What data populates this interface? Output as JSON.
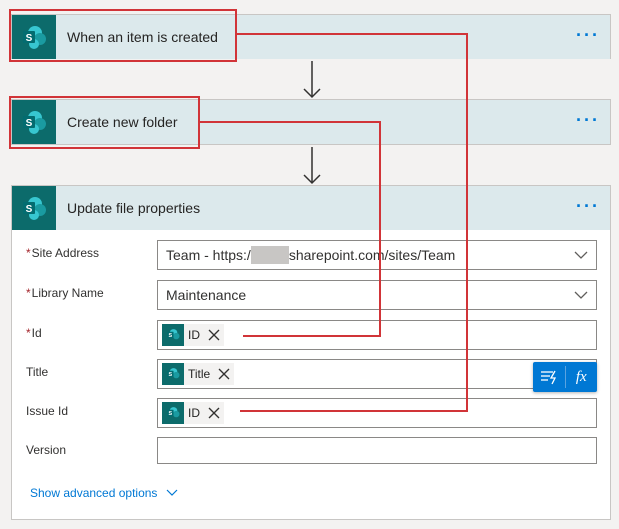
{
  "colors": {
    "accent": "#0078d4",
    "sharepoint_teal": "#0c6b6b",
    "header_bg": "#dce9ec",
    "annotation_red": "#d13438",
    "required_red": "#a4262c"
  },
  "trigger": {
    "title": "When an item is created",
    "icon": "sharepoint-icon",
    "more": "···"
  },
  "action1": {
    "title": "Create new folder",
    "icon": "sharepoint-icon",
    "more": "···"
  },
  "action2": {
    "title": "Update file properties",
    "icon": "sharepoint-icon",
    "more": "···",
    "fields": {
      "site_address": {
        "label": "Site Address",
        "required": "*",
        "value_prefix": "Team - https:/",
        "value_suffix": "sharepoint.com/sites/Team"
      },
      "library_name": {
        "label": "Library Name",
        "required": "*",
        "value": "Maintenance"
      },
      "id": {
        "label": "Id",
        "required": "*",
        "token": "ID"
      },
      "title": {
        "label": "Title",
        "token": "Title"
      },
      "issue_id": {
        "label": "Issue Id",
        "token": "ID"
      },
      "version": {
        "label": "Version",
        "value": ""
      }
    },
    "advanced_link": "Show advanced options"
  },
  "expression_toolbar": {
    "dynamic_icon": "dynamic-content-icon",
    "fx_label": "fx"
  }
}
